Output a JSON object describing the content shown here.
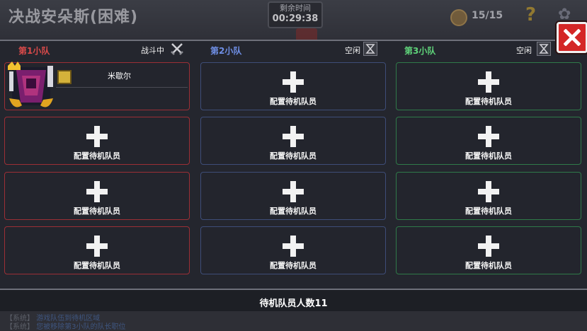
{
  "header": {
    "title": "决战安朵斯(困难)",
    "timer_label": "剩余时间",
    "timer_value": "00:29:38",
    "coins": "15/15"
  },
  "teams": [
    {
      "name": "第1小队",
      "status": "战斗中",
      "color": "#d94a4a"
    },
    {
      "name": "第2小队",
      "status": "空闲",
      "color": "#6f8fe6"
    },
    {
      "name": "第3小队",
      "status": "空闲",
      "color": "#5fd37a"
    }
  ],
  "member": {
    "name": "米歇尔"
  },
  "slot_label": "配置待机队员",
  "footer": {
    "standby_count": "待机队员人数11"
  },
  "log": [
    {
      "tag": "【系统】",
      "text": "游戏队伍到待机区域"
    },
    {
      "tag": "【系统】",
      "text": "您被移除第3小队的队长职位"
    }
  ]
}
